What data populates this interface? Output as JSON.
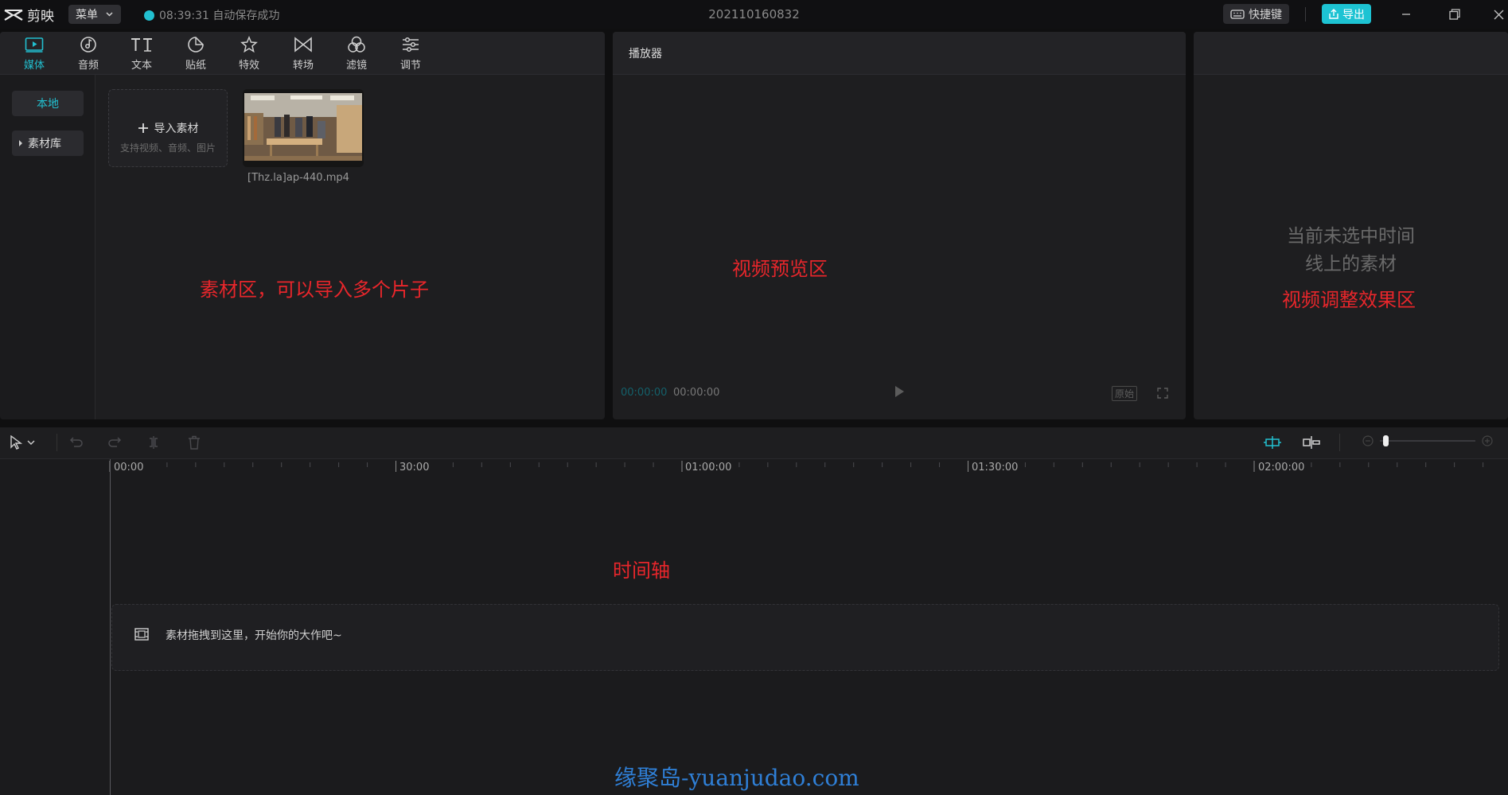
{
  "app": {
    "name": "剪映",
    "menu_label": "菜单",
    "autosave_text": "08:39:31 自动保存成功",
    "project_title": "202110160832",
    "shortcut_label": "快捷键",
    "export_label": "导出"
  },
  "media_tabs": [
    {
      "label": "媒体",
      "icon": "media-icon"
    },
    {
      "label": "音频",
      "icon": "audio-icon"
    },
    {
      "label": "文本",
      "icon": "text-icon"
    },
    {
      "label": "贴纸",
      "icon": "sticker-icon"
    },
    {
      "label": "特效",
      "icon": "effects-icon"
    },
    {
      "label": "转场",
      "icon": "transition-icon"
    },
    {
      "label": "滤镜",
      "icon": "filter-icon"
    },
    {
      "label": "调节",
      "icon": "adjust-icon"
    }
  ],
  "sidebar": {
    "local": "本地",
    "library": "素材库"
  },
  "import": {
    "label": "导入素材",
    "hint": "支持视频、音频、图片"
  },
  "media_item": {
    "filename": "[Thz.la]ap-440.mp4"
  },
  "player": {
    "title": "播放器",
    "current_time": "00:00:00",
    "total_time": "00:00:00",
    "ratio_label": "原始"
  },
  "attributes": {
    "empty_line1": "当前未选中时间",
    "empty_line2": "线上的素材"
  },
  "timeline": {
    "ticks": [
      "00:00",
      "30:00",
      "01:00:00",
      "01:30:00",
      "02:00:00"
    ],
    "drop_hint": "素材拖拽到这里，开始你的大作吧~"
  },
  "annotations": {
    "media_area": "素材区，可以导入多个片子",
    "preview_area": "视频预览区",
    "adjust_area": "视频调整效果区",
    "timeline_area": "时间轴"
  },
  "watermark": "缘聚岛-yuanjudao.com",
  "colors": {
    "accent": "#1dc3d3",
    "annotation": "#e8262b",
    "watermark": "#2f7fd6"
  }
}
